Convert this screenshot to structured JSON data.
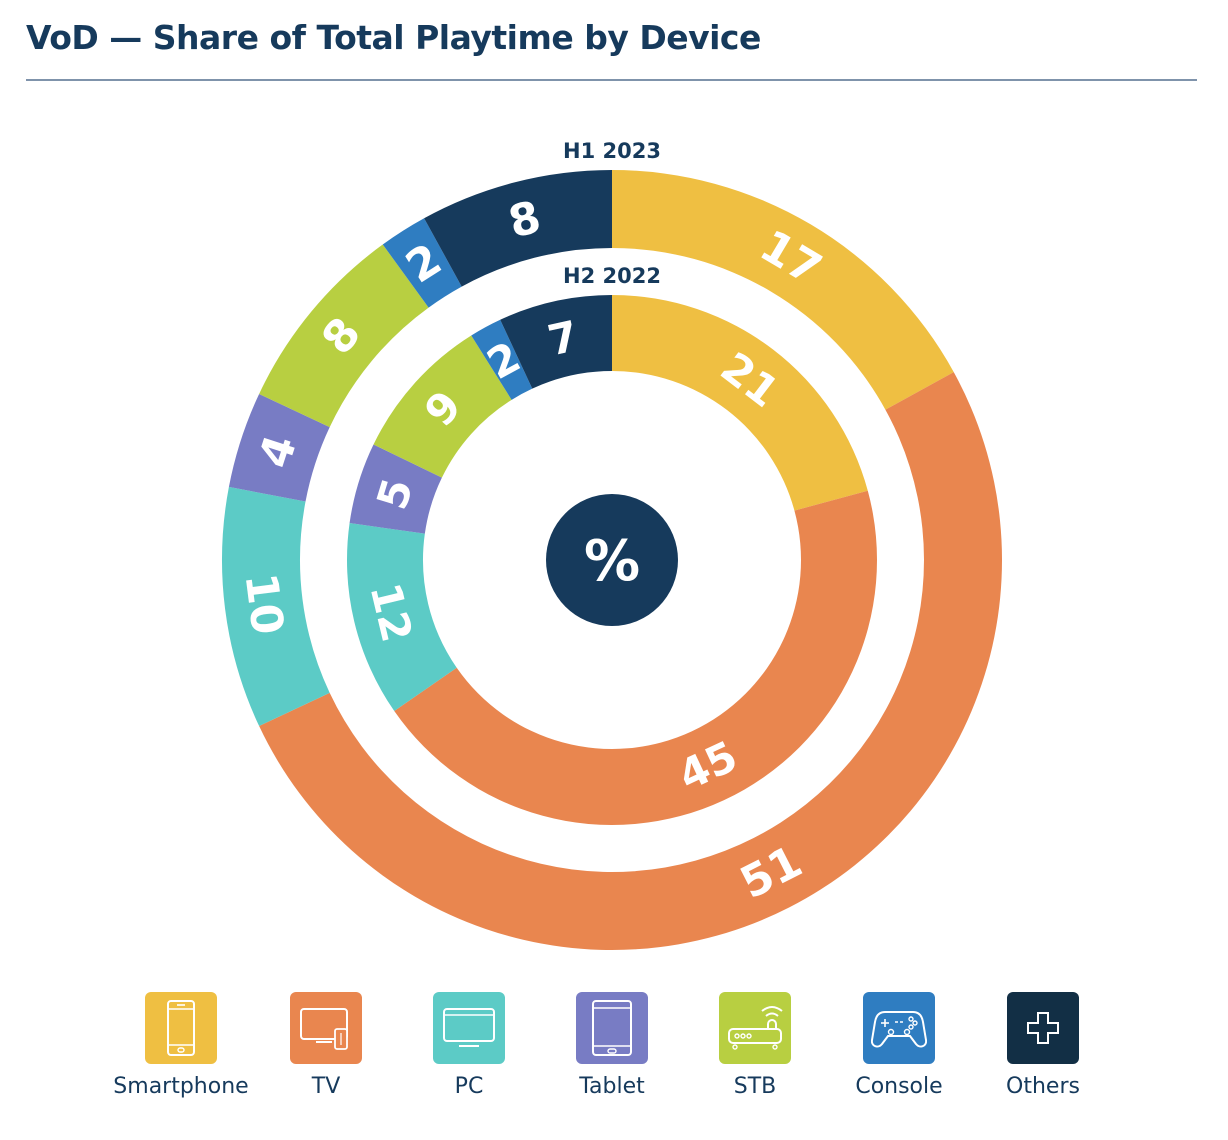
{
  "header": {
    "title": "VoD —  Share of Total Playtime by Device"
  },
  "chart_data": {
    "type": "pie",
    "subtype": "nested-donut",
    "title": "VoD —  Share of Total Playtime by Device",
    "unit_label": "%",
    "categories": [
      "Smartphone",
      "TV",
      "PC",
      "Tablet",
      "STB",
      "Console",
      "Others"
    ],
    "colors": {
      "Smartphone": "#efbf42",
      "TV": "#e9864f",
      "PC": "#5ccbc6",
      "Tablet": "#787cc4",
      "STB": "#b8cf41",
      "Console": "#2f7dc1",
      "Others": "#163a5c"
    },
    "series": [
      {
        "name": "H1 2023",
        "ring": "outer",
        "values": [
          17,
          51,
          10,
          4,
          8,
          2,
          8
        ]
      },
      {
        "name": "H2 2022",
        "ring": "inner",
        "values": [
          21,
          45,
          12,
          5,
          9,
          2,
          7
        ]
      }
    ],
    "start": "top, clockwise",
    "legend_position": "bottom"
  },
  "legend": {
    "items": [
      {
        "label": "Smartphone",
        "icon": "smartphone-icon",
        "color": "#efbf42"
      },
      {
        "label": "TV",
        "icon": "tv-icon",
        "color": "#e9864f"
      },
      {
        "label": "PC",
        "icon": "pc-monitor-icon",
        "color": "#5ccbc6"
      },
      {
        "label": "Tablet",
        "icon": "tablet-icon",
        "color": "#787cc4"
      },
      {
        "label": "STB",
        "icon": "set-top-box-icon",
        "color": "#b8cf41"
      },
      {
        "label": "Console",
        "icon": "gamepad-icon",
        "color": "#2f7dc1"
      },
      {
        "label": "Others",
        "icon": "plus-icon",
        "color": "#122f45"
      }
    ]
  },
  "center": {
    "symbol": "%",
    "color": "#163a5c"
  }
}
